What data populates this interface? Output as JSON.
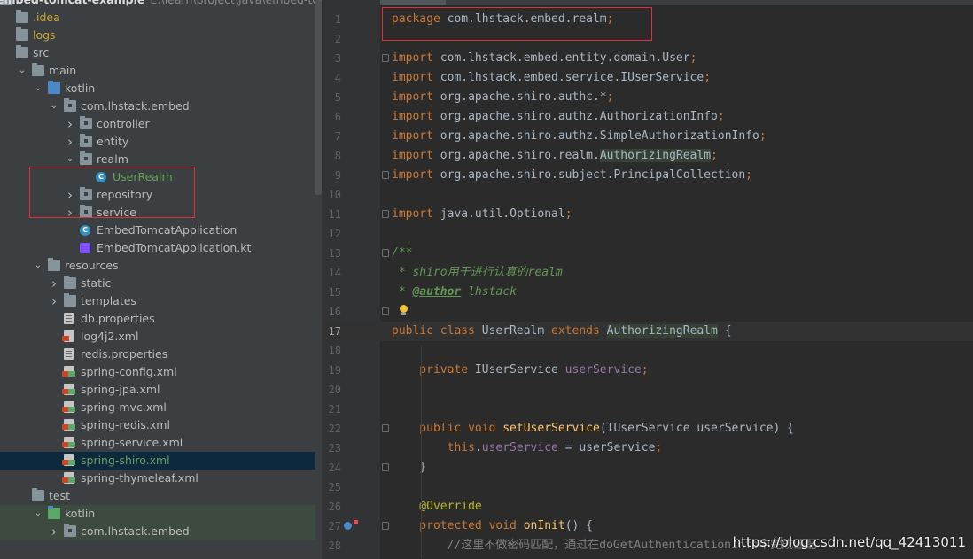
{
  "project": {
    "root_name": "embed-tomcat-example",
    "root_path": "E:\\learn\\project\\java\\embed-tomcat-e",
    "items": [
      {
        "label": "embed-tomcat-example",
        "path": "E:\\learn\\project\\java\\embed-tomcat-e",
        "depth": 0,
        "icon": "folder-icon",
        "color": "#dddddd"
      },
      {
        "label": ".idea",
        "depth": 1,
        "icon": "folder-icon",
        "color": "#c9a32e"
      },
      {
        "label": "logs",
        "depth": 1,
        "icon": "folder-icon",
        "color": "#c9a32e"
      },
      {
        "label": "src",
        "depth": 1,
        "icon": "folder-icon",
        "color": "#bbbbbb"
      },
      {
        "label": "main",
        "depth": 2,
        "icon": "folder-icon",
        "color": "#bbbbbb"
      },
      {
        "label": "kotlin",
        "depth": 3,
        "icon": "source-folder-icon",
        "color": "#bbbbbb"
      },
      {
        "label": "com.lhstack.embed",
        "depth": 4,
        "icon": "package-icon",
        "color": "#bbbbbb"
      },
      {
        "label": "controller",
        "depth": 5,
        "icon": "package-icon",
        "color": "#bbbbbb"
      },
      {
        "label": "entity",
        "depth": 5,
        "icon": "package-icon",
        "color": "#bbbbbb"
      },
      {
        "label": "realm",
        "depth": 5,
        "icon": "package-icon",
        "color": "#bbbbbb"
      },
      {
        "label": "UserRealm",
        "depth": 6,
        "icon": "class-icon",
        "color": "#6a9f5f"
      },
      {
        "label": "repository",
        "depth": 5,
        "icon": "package-icon",
        "color": "#bbbbbb"
      },
      {
        "label": "service",
        "depth": 5,
        "icon": "package-icon",
        "color": "#bbbbbb"
      },
      {
        "label": "EmbedTomcatApplication",
        "depth": 5,
        "icon": "class-icon",
        "color": "#bbbbbb"
      },
      {
        "label": "EmbedTomcatApplication.kt",
        "depth": 5,
        "icon": "kotlin-file-icon",
        "color": "#bbbbbb"
      },
      {
        "label": "resources",
        "depth": 3,
        "icon": "resources-folder-icon",
        "color": "#bbbbbb"
      },
      {
        "label": "static",
        "depth": 4,
        "icon": "folder-icon",
        "color": "#bbbbbb"
      },
      {
        "label": "templates",
        "depth": 4,
        "icon": "folder-icon",
        "color": "#bbbbbb"
      },
      {
        "label": "db.properties",
        "depth": 4,
        "icon": "properties-file-icon",
        "color": "#bbbbbb"
      },
      {
        "label": "log4j2.xml",
        "depth": 4,
        "icon": "xml-file-icon",
        "color": "#bbbbbb"
      },
      {
        "label": "redis.properties",
        "depth": 4,
        "icon": "properties-file-icon",
        "color": "#bbbbbb"
      },
      {
        "label": "spring-config.xml",
        "depth": 4,
        "icon": "spring-xml-file-icon",
        "color": "#bbbbbb"
      },
      {
        "label": "spring-jpa.xml",
        "depth": 4,
        "icon": "spring-xml-file-icon",
        "color": "#bbbbbb"
      },
      {
        "label": "spring-mvc.xml",
        "depth": 4,
        "icon": "spring-xml-file-icon",
        "color": "#bbbbbb"
      },
      {
        "label": "spring-redis.xml",
        "depth": 4,
        "icon": "spring-xml-file-icon",
        "color": "#bbbbbb"
      },
      {
        "label": "spring-service.xml",
        "depth": 4,
        "icon": "spring-xml-file-icon",
        "color": "#bbbbbb"
      },
      {
        "label": "spring-shiro.xml",
        "depth": 4,
        "icon": "spring-xml-file-icon",
        "color": "#6a9f5f",
        "selected": true
      },
      {
        "label": "spring-thymeleaf.xml",
        "depth": 4,
        "icon": "spring-xml-file-icon",
        "color": "#bbbbbb"
      },
      {
        "label": "test",
        "depth": 2,
        "icon": "folder-icon",
        "color": "#bbbbbb"
      },
      {
        "label": "kotlin",
        "depth": 3,
        "icon": "test-source-folder-icon",
        "color": "#bbbbbb"
      },
      {
        "label": "com.lhstack.embed",
        "depth": 4,
        "icon": "package-icon",
        "color": "#bbbbbb"
      }
    ]
  },
  "editor": {
    "lines": [
      {
        "n": "1",
        "tokens": [
          [
            "kw",
            "package "
          ],
          [
            "",
            "com.lhstack.embed.realm"
          ],
          [
            "kw",
            ";"
          ]
        ]
      },
      {
        "n": "2",
        "tokens": []
      },
      {
        "n": "3",
        "fold": true,
        "tokens": [
          [
            "kw",
            "import "
          ],
          [
            "",
            "com.lhstack.embed.entity.domain.User"
          ],
          [
            "kw",
            ";"
          ]
        ]
      },
      {
        "n": "4",
        "tokens": [
          [
            "kw",
            "import "
          ],
          [
            "",
            "com.lhstack.embed.service.IUserService"
          ],
          [
            "kw",
            ";"
          ]
        ]
      },
      {
        "n": "5",
        "tokens": [
          [
            "kw",
            "import "
          ],
          [
            "",
            "org.apache.shiro.authc.*"
          ],
          [
            "kw",
            ";"
          ]
        ]
      },
      {
        "n": "6",
        "tokens": [
          [
            "kw",
            "import "
          ],
          [
            "",
            "org.apache.shiro.authz.AuthorizationInfo"
          ],
          [
            "kw",
            ";"
          ]
        ]
      },
      {
        "n": "7",
        "tokens": [
          [
            "kw",
            "import "
          ],
          [
            "",
            "org.apache.shiro.authz.SimpleAuthorizationInfo"
          ],
          [
            "kw",
            ";"
          ]
        ]
      },
      {
        "n": "8",
        "tokens": [
          [
            "kw",
            "import "
          ],
          [
            "",
            "org.apache.shiro.realm."
          ],
          [
            "hlref",
            "AuthorizingRealm"
          ],
          [
            "kw",
            ";"
          ]
        ]
      },
      {
        "n": "9",
        "fold": true,
        "tokens": [
          [
            "kw",
            "import "
          ],
          [
            "",
            "org.apache.shiro.subject.PrincipalCollection"
          ],
          [
            "kw",
            ";"
          ]
        ]
      },
      {
        "n": "10",
        "tokens": []
      },
      {
        "n": "11",
        "fold": true,
        "tokens": [
          [
            "kw",
            "import "
          ],
          [
            "",
            "java.util.Optional"
          ],
          [
            "kw",
            ";"
          ]
        ]
      },
      {
        "n": "12",
        "tokens": []
      },
      {
        "n": "13",
        "fold": true,
        "tokens": [
          [
            "cmt",
            "/**"
          ]
        ]
      },
      {
        "n": "14",
        "tokens": [
          [
            "cmt",
            " * shiro用于进行认真的realm"
          ]
        ]
      },
      {
        "n": "15",
        "tokens": [
          [
            "cmt",
            " * "
          ],
          [
            "cmtann",
            "@author"
          ],
          [
            "cmt",
            " lhstack"
          ]
        ]
      },
      {
        "n": "16",
        "fold": true,
        "bulb": true,
        "tokens": [
          [
            "cmt",
            " "
          ]
        ]
      },
      {
        "n": "17",
        "current": true,
        "tokens": [
          [
            "kw",
            "public class "
          ],
          [
            "",
            "UserRealm "
          ],
          [
            "kw",
            "extends "
          ],
          [
            "hlref",
            "AuthorizingRealm"
          ],
          [
            "",
            " {"
          ]
        ]
      },
      {
        "n": "18",
        "tokens": []
      },
      {
        "n": "19",
        "tokens": [
          [
            "",
            " "
          ],
          [
            "kw",
            "   private "
          ],
          [
            "",
            "IUserService "
          ],
          [
            "fld",
            "userService"
          ],
          [
            "kw",
            ";"
          ]
        ]
      },
      {
        "n": "20",
        "tokens": []
      },
      {
        "n": "21",
        "tokens": []
      },
      {
        "n": "22",
        "fold": true,
        "tokens": [
          [
            "kw",
            "    public void "
          ],
          [
            "fn",
            "setUserService"
          ],
          [
            "",
            "(IUserService userService) {"
          ]
        ]
      },
      {
        "n": "23",
        "tokens": [
          [
            "kw",
            "        this"
          ],
          [
            "",
            "."
          ],
          [
            "fld",
            "userService"
          ],
          [
            "",
            " = userService"
          ],
          [
            "kw",
            ";"
          ]
        ]
      },
      {
        "n": "24",
        "fold": true,
        "tokens": [
          [
            "",
            "    }"
          ]
        ]
      },
      {
        "n": "25",
        "tokens": []
      },
      {
        "n": "26",
        "tokens": [
          [
            "ann",
            "    @Override"
          ]
        ]
      },
      {
        "n": "27",
        "fold": true,
        "override": true,
        "tokens": [
          [
            "kw",
            "    protected void "
          ],
          [
            "fn",
            "onInit"
          ],
          [
            "",
            "() {"
          ]
        ]
      },
      {
        "n": "28",
        "tokens": [
          [
            "cmt2",
            "        //这里不做密码匹配，通过在doGetAuthenticationInfo中完成匹配"
          ]
        ]
      }
    ]
  },
  "watermark": "https://blog.csdn.net/qq_42413011"
}
